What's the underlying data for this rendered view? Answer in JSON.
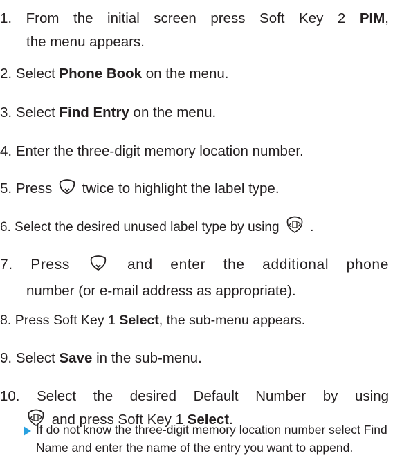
{
  "steps": [
    {
      "num": "1.",
      "parts": [
        "From the initial screen press Soft Key 2 ",
        "PIM",
        ","
      ],
      "cont": "the menu appears."
    },
    {
      "num": "2.",
      "parts": [
        "Select ",
        "Phone Book",
        " on the menu."
      ]
    },
    {
      "num": "3.",
      "parts": [
        "Select ",
        "Find Entry",
        " on the menu."
      ]
    },
    {
      "num": "4.",
      "text": "Enter the three-digit memory location number."
    },
    {
      "num": "5.",
      "before": "Press",
      "after": "twice to highlight the label type.",
      "icon": "nav-down-key-icon"
    },
    {
      "num": "6.",
      "before": "Select the desired unused label type by using",
      "after": ".",
      "icon": "nav-scroll-key-icon"
    },
    {
      "num": "7.",
      "before": "Press",
      "after": "and enter the additional phone",
      "cont": "number (or e-mail address as appropriate).",
      "icon": "nav-down-key-icon"
    },
    {
      "num": "8.",
      "parts": [
        "Press Soft Key 1 ",
        "Select",
        ", the sub-menu appears."
      ]
    },
    {
      "num": "9.",
      "parts": [
        "Select ",
        "Save",
        " in the sub-menu."
      ]
    },
    {
      "num": "10.",
      "text": "Select the desired Default Number by using",
      "cont_parts": [
        "and press Soft Key 1 ",
        "Select",
        "."
      ],
      "icon": "nav-scroll-key-icon"
    }
  ],
  "note": {
    "text": "If do not know the three-digit memory location number select Find Name and enter the name of the entry you want to append.",
    "accent_color": "#2aa1e0"
  }
}
